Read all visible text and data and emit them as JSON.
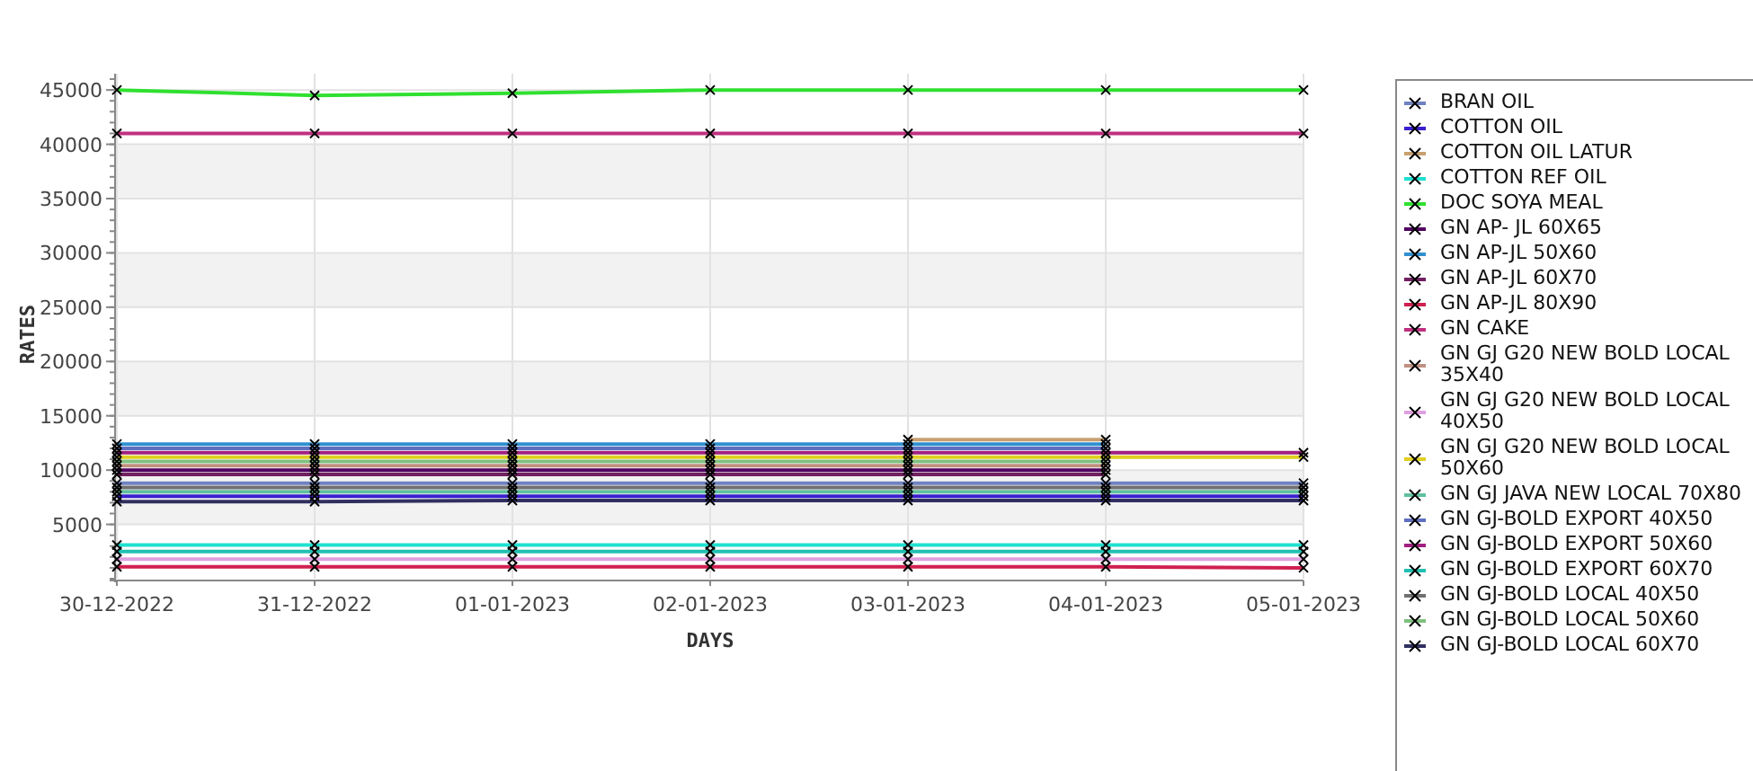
{
  "chart": {
    "chart_data": {
      "type": "line",
      "grid": true,
      "xlabel": "DAYS",
      "ylabel": "RATES",
      "categories": [
        "30-12-2022",
        "31-12-2022",
        "01-01-2023",
        "02-01-2023",
        "03-01-2023",
        "04-01-2023",
        "05-01-2023"
      ],
      "ylim": [
        0,
        46500
      ],
      "yticks": [
        5000,
        10000,
        15000,
        20000,
        25000,
        30000,
        35000,
        40000,
        45000
      ],
      "series": [
        {
          "name": "BRAN OIL",
          "color": "#6f82c0",
          "marker": "cross",
          "values": [
            8800,
            8800,
            8800,
            8800,
            8800,
            8800,
            8800
          ]
        },
        {
          "name": "COTTON OIL",
          "color": "#3b1fd0",
          "marker": "cross",
          "values": [
            7600,
            7600,
            7600,
            7600,
            7600,
            7600,
            7600
          ]
        },
        {
          "name": "COTTON OIL LATUR",
          "color": "#c8a070",
          "marker": "cross",
          "values": [
            null,
            null,
            null,
            null,
            12800,
            12800,
            null
          ]
        },
        {
          "name": "COTTON REF OIL",
          "color": "#20e0d0",
          "marker": "cross",
          "values": [
            3100,
            3100,
            3100,
            3100,
            3100,
            3100,
            3100
          ]
        },
        {
          "name": "DOC SOYA MEAL",
          "color": "#30e030",
          "marker": "cross",
          "values": [
            45000,
            44500,
            44700,
            45000,
            45000,
            45000,
            45000
          ]
        },
        {
          "name": "GN AP- JL 60X65",
          "color": "#500060",
          "marker": "cross",
          "values": [
            10000,
            10000,
            10000,
            10000,
            10000,
            10000,
            null
          ]
        },
        {
          "name": "GN AP-JL 50X60",
          "color": "#3090d0",
          "marker": "cross",
          "values": [
            12400,
            12400,
            12400,
            12400,
            12400,
            12400,
            null
          ]
        },
        {
          "name": "GN AP-JL 60X70",
          "color": "#702060",
          "marker": "cross",
          "values": [
            9600,
            9600,
            9600,
            9600,
            9600,
            9600,
            null
          ]
        },
        {
          "name": "GN AP-JL 80X90",
          "color": "#d02050",
          "marker": "cross",
          "values": [
            1100,
            1100,
            1100,
            1100,
            1100,
            1100,
            1000
          ]
        },
        {
          "name": "GN CAKE",
          "color": "#c03080",
          "marker": "cross",
          "values": [
            41000,
            41000,
            41000,
            41000,
            41000,
            41000,
            41000
          ]
        },
        {
          "name": "GN GJ G20 NEW BOLD LOCAL 35X40",
          "color": "#c09080",
          "marker": "cross",
          "values": [
            10400,
            10400,
            10400,
            10400,
            10400,
            10400,
            null
          ]
        },
        {
          "name": "GN GJ G20 NEW BOLD LOCAL 40X50",
          "color": "#e0a0e0",
          "marker": "cross",
          "values": [
            1800,
            1800,
            1800,
            1800,
            1800,
            1800,
            1800
          ]
        },
        {
          "name": "GN GJ G20 NEW BOLD LOCAL 50X60",
          "color": "#e0d020",
          "marker": "cross",
          "values": [
            11200,
            11200,
            11200,
            11200,
            11200,
            11200,
            11200
          ]
        },
        {
          "name": "GN GJ JAVA NEW LOCAL 70X80",
          "color": "#60c0a0",
          "marker": "cross",
          "values": [
            8000,
            8000,
            8000,
            8000,
            8000,
            8000,
            8000
          ]
        },
        {
          "name": "GN GJ-BOLD EXPORT 40X50",
          "color": "#6070c0",
          "marker": "cross",
          "values": [
            12000,
            12000,
            12000,
            12000,
            12000,
            12000,
            null
          ]
        },
        {
          "name": "GN GJ-BOLD EXPORT 50X60",
          "color": "#a02080",
          "marker": "cross",
          "values": [
            11600,
            11600,
            11600,
            11600,
            11600,
            11600,
            11600
          ]
        },
        {
          "name": "GN GJ-BOLD EXPORT 60X70",
          "color": "#20c0b0",
          "marker": "cross",
          "values": [
            2500,
            2500,
            2500,
            2500,
            2500,
            2500,
            2500
          ]
        },
        {
          "name": "GN GJ-BOLD LOCAL 40X50",
          "color": "#707070",
          "marker": "cross",
          "values": [
            8400,
            8400,
            8400,
            8400,
            8400,
            8400,
            8400
          ]
        },
        {
          "name": "GN GJ-BOLD LOCAL 50X60",
          "color": "#80c080",
          "marker": "cross",
          "values": [
            10800,
            10800,
            10800,
            10800,
            10800,
            10800,
            null
          ]
        },
        {
          "name": "GN GJ-BOLD LOCAL 60X70",
          "color": "#303060",
          "marker": "cross",
          "values": [
            7100,
            7100,
            7200,
            7200,
            7200,
            7200,
            7200
          ]
        }
      ]
    }
  }
}
